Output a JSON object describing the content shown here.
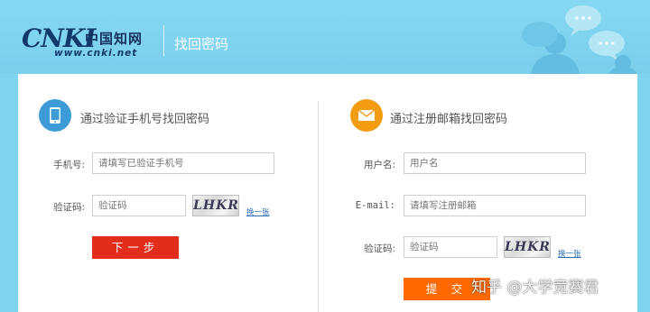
{
  "header": {
    "logo_text": "CNKI",
    "logo_cn": "中国知网",
    "logo_url": "www.cnki.net",
    "page_title": "找回密码"
  },
  "phone_section": {
    "title": "通过验证手机号找回密码",
    "phone_label": "手机号:",
    "phone_placeholder": "请填写已验证手机号",
    "captcha_label": "验证码:",
    "captcha_placeholder": "验证码",
    "captcha_text": "LHKR",
    "refresh_label": "换一张",
    "next_button": "下一步"
  },
  "email_section": {
    "title": "通过注册邮箱找回密码",
    "username_label": "用户名:",
    "username_placeholder": "用户名",
    "email_label": "E-mail:",
    "email_placeholder": "请填写注册邮箱",
    "captcha_label": "验证码:",
    "captcha_placeholder": "验证码",
    "captcha_text": "LHKR",
    "refresh_label": "换一张",
    "submit_button": "提 交"
  },
  "watermark": "知乎 @大学竞赛君",
  "colors": {
    "background": "#7fd3ee",
    "phone_icon_bg": "#3d9bd6",
    "email_icon_bg": "#f39c12",
    "next_button": "#e22d1d",
    "submit_button": "#ff6a00"
  },
  "icons": {
    "phone": "tablet-icon",
    "email": "envelope-icon"
  }
}
